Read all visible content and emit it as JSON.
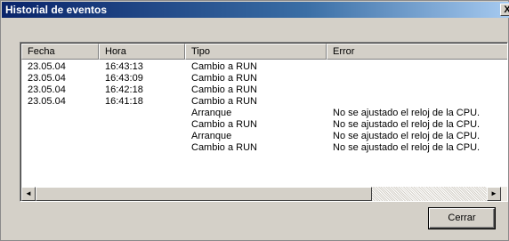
{
  "window": {
    "title": "Historial de eventos",
    "close_glyph": "X"
  },
  "table": {
    "columns": [
      "Fecha",
      "Hora",
      "Tipo",
      "Error"
    ],
    "rows": [
      {
        "fecha": "23.05.04",
        "hora": "16:43:13",
        "tipo": "Cambio a RUN",
        "error": ""
      },
      {
        "fecha": "23.05.04",
        "hora": "16:43:09",
        "tipo": "Cambio a RUN",
        "error": ""
      },
      {
        "fecha": "23.05.04",
        "hora": "16:42:18",
        "tipo": "Cambio a RUN",
        "error": ""
      },
      {
        "fecha": "23.05.04",
        "hora": "16:41:18",
        "tipo": "Cambio a RUN",
        "error": ""
      },
      {
        "fecha": "",
        "hora": "",
        "tipo": "Arranque",
        "error": "No se ajustado el reloj de la CPU."
      },
      {
        "fecha": "",
        "hora": "",
        "tipo": "Cambio a RUN",
        "error": "No se ajustado el reloj de la CPU."
      },
      {
        "fecha": "",
        "hora": "",
        "tipo": "Arranque",
        "error": "No se ajustado el reloj de la CPU."
      },
      {
        "fecha": "",
        "hora": "",
        "tipo": "Cambio a RUN",
        "error": "No se ajustado el reloj de la CPU."
      }
    ]
  },
  "scrollbar": {
    "left_arrow": "◄",
    "right_arrow": "►"
  },
  "buttons": {
    "close_label": "Cerrar"
  },
  "colors": {
    "titlebar_start": "#0a246a",
    "titlebar_end": "#a6caf0",
    "dialog_bg": "#d4d0c8"
  }
}
